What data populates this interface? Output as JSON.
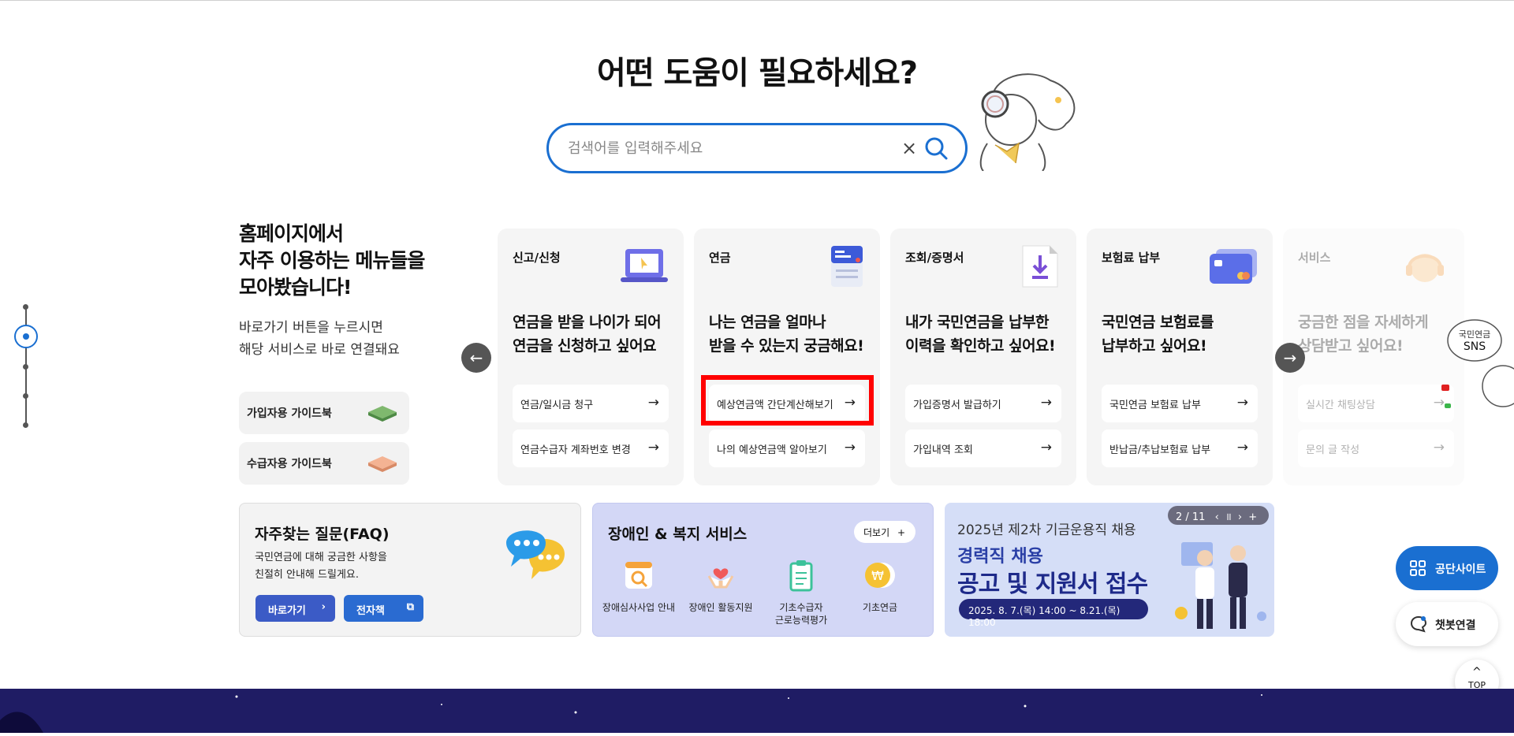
{
  "hero": {
    "title": "어떤 도움이 필요하세요?"
  },
  "search": {
    "placeholder": "검색어를 입력해주세요",
    "clear": "×"
  },
  "intro": {
    "title_lines": [
      "홈페이지에서",
      "자주 이용하는 메뉴들을",
      "모아봤습니다!"
    ],
    "desc_lines": [
      "바로가기 버튼을 누르시면",
      "해당 서비스로 바로 연결돼요"
    ]
  },
  "guides": [
    "가입자용 가이드북",
    "수급자용 가이드북"
  ],
  "cards": [
    {
      "category": "신고/신청",
      "desc": [
        "연금을 받을 나이가 되어",
        "연금을 신청하고 싶어요"
      ],
      "links": [
        "연금/일시금 청구",
        "연금수급자 계좌번호 변경"
      ]
    },
    {
      "category": "연금",
      "desc": [
        "나는 연금을 얼마나",
        "받을 수 있는지 궁금해요!"
      ],
      "links": [
        "예상연금액 간단계산해보기",
        "나의 예상연금액 알아보기"
      ]
    },
    {
      "category": "조회/증명서",
      "desc": [
        "내가 국민연금을 납부한",
        "이력을 확인하고 싶어요!"
      ],
      "links": [
        "가입증명서 발급하기",
        "가입내역 조회"
      ]
    },
    {
      "category": "보험료 납부",
      "desc": [
        "국민연금 보험료를",
        "납부하고 싶어요!"
      ],
      "links": [
        "국민연금 보험료 납부",
        "반납금/추납보험료 납부"
      ]
    },
    {
      "category": "서비스",
      "desc": [
        "궁금한 점을 자세하게",
        "상담받고 싶어요!"
      ],
      "links": [
        "실시간 채팅상담",
        "문의 글 작성"
      ]
    }
  ],
  "faq": {
    "title": "자주찾는 질문(FAQ)",
    "desc_lines": [
      "국민연금에 대해 궁금한 사항을",
      "친절히 안내해 드릴게요."
    ],
    "btn_go": "바로가기",
    "btn_book": "전자책"
  },
  "welfare": {
    "title": "장애인 & 복지 서비스",
    "more": "더보기",
    "items": [
      {
        "label": "장애심사사업 안내",
        "icon": "search-doc-icon"
      },
      {
        "label": "장애인 활동지원",
        "icon": "heart-hands-icon"
      },
      {
        "label": "기초수급자 근로능력평가",
        "label_lines": [
          "기초수급자",
          "근로능력평가"
        ],
        "icon": "clipboard-icon"
      },
      {
        "label": "기초연금",
        "icon": "won-coin-icon"
      }
    ]
  },
  "banner": {
    "line1": "2025년 제2차 기금운용직 채용",
    "line2": "경력직 채용",
    "line3": "공고 및 지원서 접수",
    "date": "2025. 8. 7.(목) 14:00 ~ 8.21.(목) 18:00",
    "pager": "2 / 11"
  },
  "sns": {
    "label_lines": [
      "국민연금",
      "SNS"
    ]
  },
  "side": {
    "site": "공단사이트",
    "chatbot": "챗봇연결",
    "top": "TOP"
  },
  "colors": {
    "primary": "#1a6fd1",
    "highlight": "#ff0000",
    "footer": "#1f1c64"
  }
}
